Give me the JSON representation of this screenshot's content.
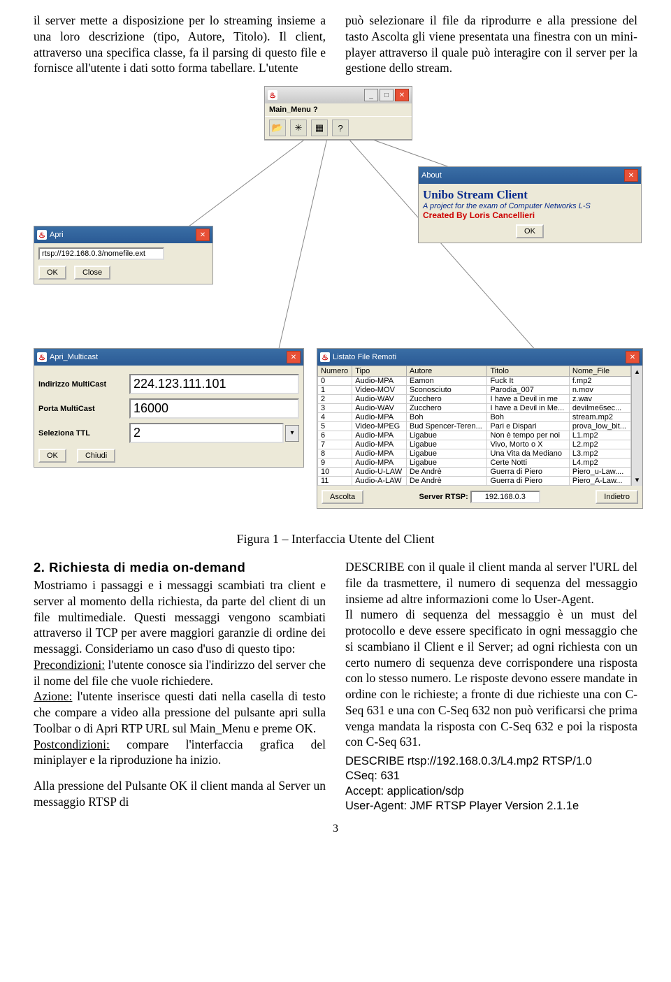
{
  "intro_col1": "il server mette a disposizione per lo streaming insieme a una loro descrizione (tipo, Autore, Titolo). Il client, attraverso una specifica classe, fa il parsing di questo file e fornisce all'utente i dati sotto forma tabellare. L'utente",
  "intro_col2": "può selezionare il file da riprodurre e alla pressione del tasto Ascolta gli viene presentata una finestra con un mini-player attraverso il quale può interagire con il server per la gestione dello stream.",
  "main_menu": {
    "title": "",
    "menu": "Main_Menu   ?"
  },
  "apri": {
    "title": "Apri",
    "url": "rtsp://192.168.0.3/nomefile.ext",
    "ok": "OK",
    "close": "Close"
  },
  "about": {
    "title": "About",
    "line1": "Unibo Stream Client",
    "line2": "A project for the exam of Computer Networks L-S",
    "line3": "Created By Loris Cancellieri",
    "ok": "OK"
  },
  "multicast": {
    "title": "Apri_Multicast",
    "addr_label": "Indirizzo MultiCast",
    "addr": "224.123.111.101",
    "port_label": "Porta MultiCast",
    "port": "16000",
    "ttl_label": "Seleziona TTL",
    "ttl": "2",
    "ok": "OK",
    "close": "Chiudi"
  },
  "listato": {
    "title": "Listato File Remoti",
    "headers": [
      "Numero",
      "Tipo",
      "Autore",
      "Titolo",
      "Nome_File"
    ],
    "rows": [
      [
        "0",
        "Audio-MPA",
        "Eamon",
        "Fuck It",
        "f.mp2"
      ],
      [
        "1",
        "Video-MOV",
        "Sconosciuto",
        "Parodia_007",
        "n.mov"
      ],
      [
        "2",
        "Audio-WAV",
        "Zucchero",
        "I have a Devil in me",
        "z.wav"
      ],
      [
        "3",
        "Audio-WAV",
        "Zucchero",
        "I have a Devil in Me...",
        "devilme6sec..."
      ],
      [
        "4",
        "Audio-MPA",
        "Boh",
        "Boh",
        "stream.mp2"
      ],
      [
        "5",
        "Video-MPEG",
        "Bud Spencer-Teren...",
        "Pari e Dispari",
        "prova_low_bit..."
      ],
      [
        "6",
        "Audio-MPA",
        "Ligabue",
        "Non è tempo per noi",
        "L1.mp2"
      ],
      [
        "7",
        "Audio-MPA",
        "Ligabue",
        "Vivo, Morto o X",
        "L2.mp2"
      ],
      [
        "8",
        "Audio-MPA",
        "Ligabue",
        "Una Vita da Mediano",
        "L3.mp2"
      ],
      [
        "9",
        "Audio-MPA",
        "Ligabue",
        "Certe Notti",
        "L4.mp2"
      ],
      [
        "10",
        "Audio-U-LAW",
        "De Andrè",
        "Guerra di Piero",
        "Piero_u-Law...."
      ],
      [
        "11",
        "Audio-A-LAW",
        "De Andrè",
        "Guerra di Piero",
        "Piero_A-Law..."
      ]
    ],
    "ascolta": "Ascolta",
    "server_label": "Server RTSP:",
    "server_ip": "192.168.0.3",
    "indietro": "Indietro"
  },
  "caption": "Figura 1 – Interfaccia Utente del Client",
  "section2_title": "2. Richiesta di media on-demand",
  "section2_left": "Mostriamo i passaggi e i messaggi scambiati tra client e server al momento della richiesta, da parte del client di un file multimediale. Questi messaggi vengono scambiati attraverso il TCP per avere maggiori garanzie di ordine dei messaggi. Consideriamo un caso d'uso di questo tipo:",
  "pre_label": "Precondizioni:",
  "pre_text": " l'utente conosce sia l'indirizzo del server che il nome del file che vuole richiedere.",
  "az_label": "Azione:",
  "az_text": " l'utente inserisce questi dati nella casella di testo che compare a video alla pressione del pulsante apri sulla Toolbar o di Apri RTP URL sul Main_Menu e preme OK.",
  "post_label": "Postcondizioni:",
  "post_text": " compare l'interfaccia grafica del miniplayer e la riproduzione ha inizio.",
  "left_tail": "Alla pressione del Pulsante OK il client manda al Server un messaggio RTSP di",
  "right_p1": "DESCRIBE con il quale il client manda al server l'URL del file da trasmettere, il numero di sequenza del messaggio insieme ad altre informazioni come lo User-Agent.",
  "right_p2": "Il numero di sequenza del messaggio è un must del protocollo e deve essere specificato in ogni messaggio che si scambiano il Client e il Server; ad ogni richiesta con un certo numero di sequenza deve corrispondere una risposta con lo stesso numero. Le risposte devono essere mandate in ordine con le richieste; a fronte di due richieste una con C-Seq 631 e una con C-Seq 632 non può verificarsi che prima venga mandata la risposta con C-Seq 632 e poi la risposta con C-Seq 631.",
  "msg": {
    "l1": "DESCRIBE rtsp://192.168.0.3/L4.mp2 RTSP/1.0",
    "l2": "CSeq: 631",
    "l3": "Accept: application/sdp",
    "l4": "User-Agent: JMF RTSP Player Version 2.1.1e"
  },
  "pagenum": "3"
}
